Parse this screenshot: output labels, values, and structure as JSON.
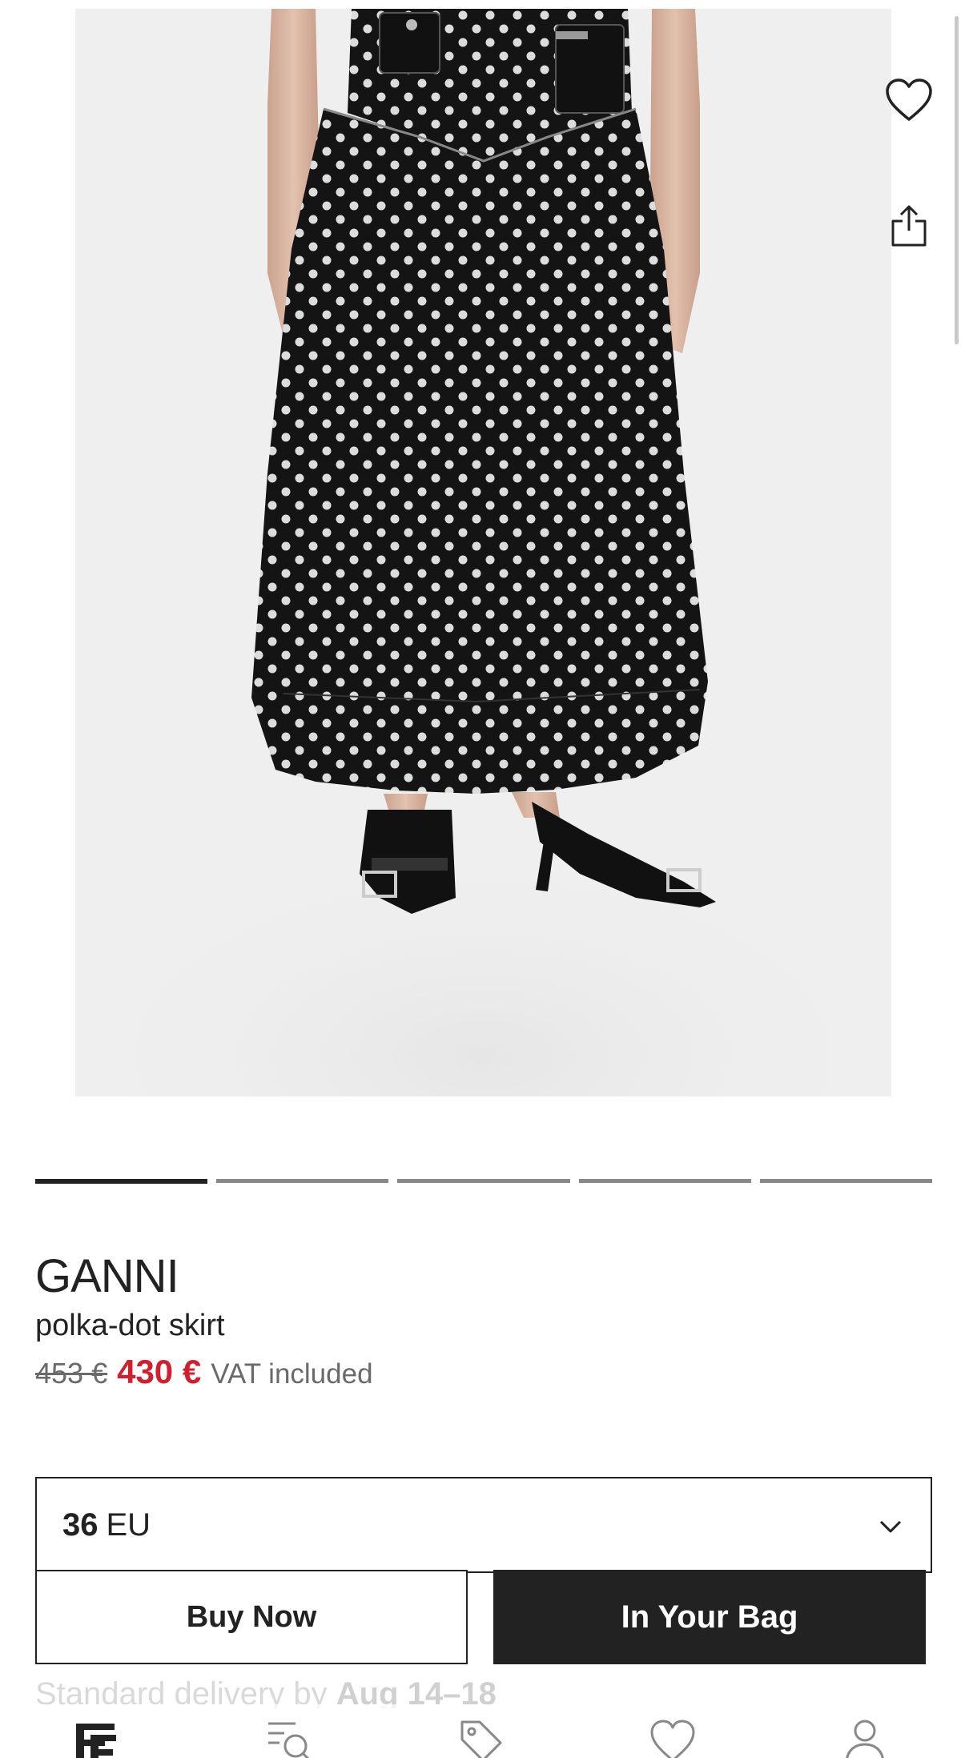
{
  "product": {
    "brand": "GANNI",
    "name": "polka-dot skirt",
    "price_old": "453 €",
    "price_new": "430 €",
    "price_note": "VAT included"
  },
  "gallery": {
    "image_count": 5,
    "active_index": 0
  },
  "size_selector": {
    "value": "36",
    "unit": "EU"
  },
  "actions": {
    "buy_now_label": "Buy Now",
    "bag_label": "In Your Bag"
  },
  "delivery": {
    "prefix": "Standard delivery by ",
    "dates": "Aug 14–18"
  },
  "icons": {
    "wishlist": "heart-icon",
    "share": "share-icon",
    "chevron": "chevron-down-icon",
    "nav": [
      "farfetch-logo-icon",
      "search-icon",
      "tag-icon",
      "heart-icon",
      "user-icon"
    ]
  },
  "colors": {
    "sale_red": "#d0202f",
    "text": "#222222",
    "muted": "#6a6a6a"
  }
}
